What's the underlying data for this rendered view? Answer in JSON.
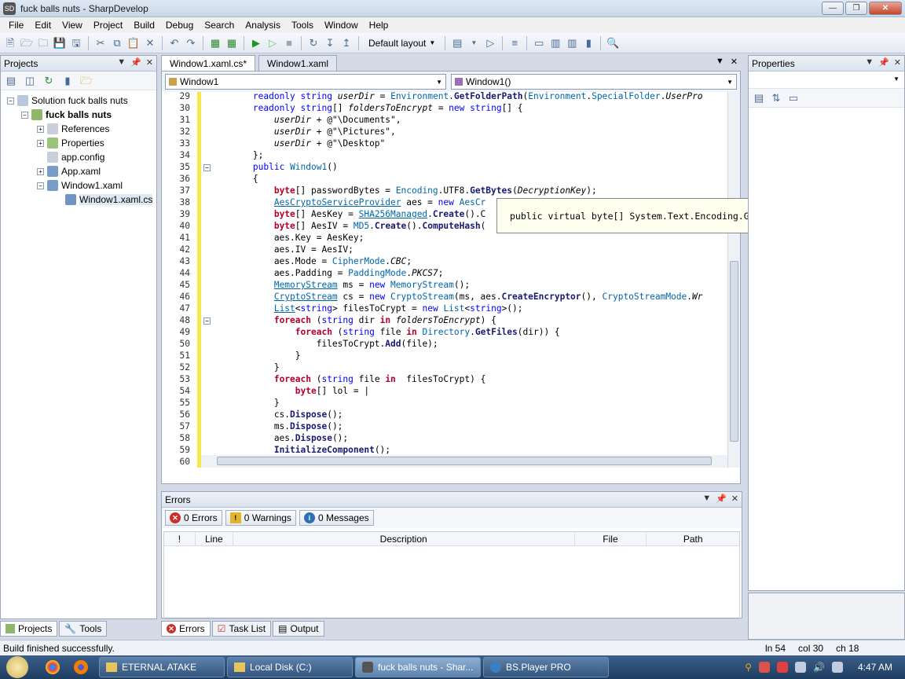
{
  "window": {
    "title": "fuck balls nuts - SharpDevelop",
    "icon_text": "SD"
  },
  "menu": [
    "File",
    "Edit",
    "View",
    "Project",
    "Build",
    "Debug",
    "Search",
    "Analysis",
    "Tools",
    "Window",
    "Help"
  ],
  "toolbar": {
    "layout_label": "Default layout"
  },
  "projects_panel": {
    "title": "Projects",
    "tree": [
      {
        "label": "Solution fuck balls nuts",
        "bold": false
      },
      {
        "label": "fuck balls nuts",
        "bold": true
      },
      {
        "label": "References",
        "bold": false
      },
      {
        "label": "Properties",
        "bold": false
      },
      {
        "label": "app.config",
        "bold": false
      },
      {
        "label": "App.xaml",
        "bold": false
      },
      {
        "label": "Window1.xaml",
        "bold": false
      },
      {
        "label": "Window1.xaml.cs",
        "bold": false
      }
    ],
    "tabs": [
      "Projects",
      "Tools"
    ]
  },
  "editor": {
    "tabs": [
      "Window1.xaml.cs*",
      "Window1.xaml"
    ],
    "class_combo": "Window1",
    "member_combo": "Window1()",
    "line_numbers": [
      "29",
      "30",
      "31",
      "32",
      "33",
      "34",
      "35",
      "36",
      "37",
      "38",
      "39",
      "40",
      "41",
      "42",
      "43",
      "44",
      "45",
      "46",
      "47",
      "48",
      "49",
      "50",
      "51",
      "52",
      "53",
      "54",
      "55",
      "56",
      "57",
      "58",
      "59",
      "60"
    ],
    "tooltip": "public virtual byte[] System.Text.Encoding.GetBytes(string s);"
  },
  "properties_panel": {
    "title": "Properties"
  },
  "errors_panel": {
    "title": "Errors",
    "errors_btn": "0 Errors",
    "warnings_btn": "0 Warnings",
    "messages_btn": "0 Messages",
    "columns": [
      "!",
      "Line",
      "Description",
      "File",
      "Path"
    ],
    "tabs": [
      "Errors",
      "Task List",
      "Output"
    ]
  },
  "status": {
    "message": "Build finished successfully.",
    "ln": "ln 54",
    "col": "col 30",
    "ch": "ch 18"
  },
  "taskbar": {
    "buttons": [
      "ETERNAL ATAKE",
      "Local Disk (C:)",
      "fuck balls nuts - Shar...",
      "BS.Player PRO"
    ],
    "clock": "4:47 AM"
  }
}
